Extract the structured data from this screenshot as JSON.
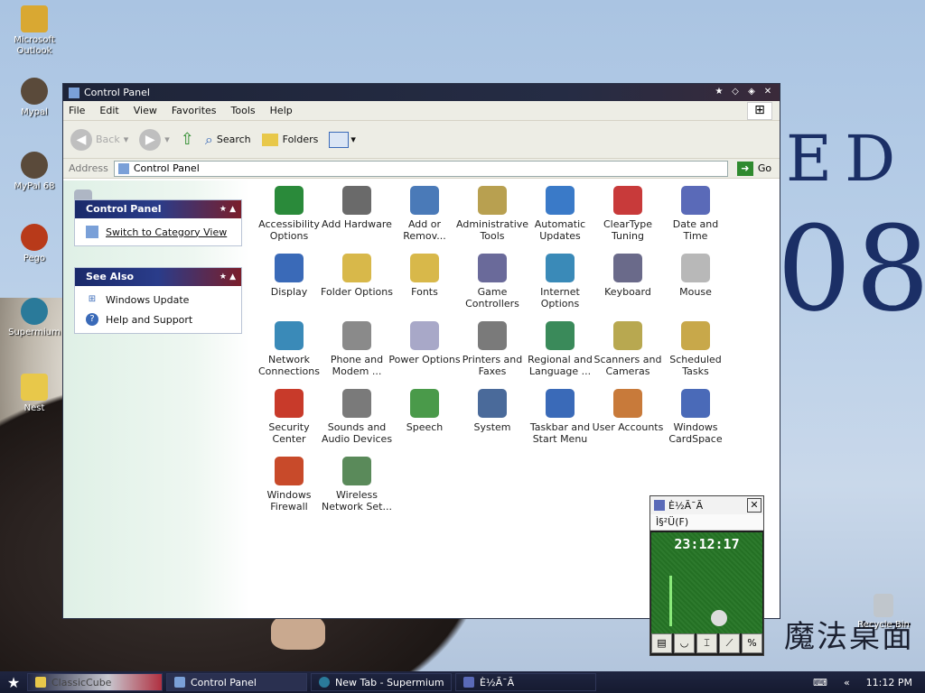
{
  "desktop": {
    "icons": [
      {
        "label": "Microsoft Outlook",
        "color": "#d9a832"
      },
      {
        "label": "Mypal",
        "color": "#5a4a3a"
      },
      {
        "label": "MyPal 68",
        "color": "#5a4a3a"
      },
      {
        "label": "Pego",
        "color": "#b83a1a"
      },
      {
        "label": "Supermium",
        "color": "#2a7a9a"
      },
      {
        "label": "Nest",
        "color": "#e8c84a"
      }
    ],
    "wallpaper_text_top": "ED",
    "wallpaper_text_big": "08",
    "wallpaper_logo": "魔法桌面",
    "recycle_bin": "Recycle Bin"
  },
  "window": {
    "title": "Control Panel",
    "menu": [
      "File",
      "Edit",
      "View",
      "Favorites",
      "Tools",
      "Help"
    ],
    "toolbar": {
      "back": "Back",
      "search": "Search",
      "folders": "Folders"
    },
    "address_label": "Address",
    "address_value": "Control Panel",
    "go": "Go",
    "left_panels": {
      "control_panel": {
        "title": "Control Panel",
        "link": "Switch to Category View"
      },
      "see_also": {
        "title": "See Also",
        "links": [
          "Windows Update",
          "Help and Support"
        ]
      }
    },
    "items": [
      "Accessibility Options",
      "Add Hardware",
      "Add or Remov...",
      "Administrative Tools",
      "Automatic Updates",
      "ClearType Tuning",
      "Date and Time",
      "Display",
      "Folder Options",
      "Fonts",
      "Game Controllers",
      "Internet Options",
      "Keyboard",
      "Mouse",
      "Network Connections",
      "Phone and Modem ...",
      "Power Options",
      "Printers and Faxes",
      "Regional and Language ...",
      "Scanners and Cameras",
      "Scheduled Tasks",
      "Security Center",
      "Sounds and Audio Devices",
      "Speech",
      "System",
      "Taskbar and Start Menu",
      "User Accounts",
      "Windows CardSpace",
      "Windows Firewall",
      "Wireless Network Set..."
    ],
    "item_colors": [
      "#2a8a3a",
      "#6a6a6a",
      "#4a7ab8",
      "#b8a050",
      "#3a7ac8",
      "#c83a3a",
      "#5a6ab8",
      "#3a6ab8",
      "#d8b84a",
      "#d8b84a",
      "#6a6a9a",
      "#3a8ab8",
      "#6a6a8a",
      "#b8b8b8",
      "#3a8ab8",
      "#8a8a8a",
      "#a8a8c8",
      "#7a7a7a",
      "#3a8a5a",
      "#b8a850",
      "#c8a84a",
      "#c83a2a",
      "#7a7a7a",
      "#4a9a4a",
      "#4a6a9a",
      "#3a6ab8",
      "#c87a3a",
      "#4a6ab8",
      "#c84a2a",
      "#5a8a5a"
    ]
  },
  "gadget": {
    "title": "È½Ã¯Ã",
    "menu": "Ì§²Ü(F)",
    "time": "23:12:17"
  },
  "taskbar": {
    "tasks": [
      "ClassicCube",
      "Control Panel",
      "New Tab - Supermium",
      "È½Ã¯Ã"
    ],
    "clock": "11:12 PM"
  }
}
